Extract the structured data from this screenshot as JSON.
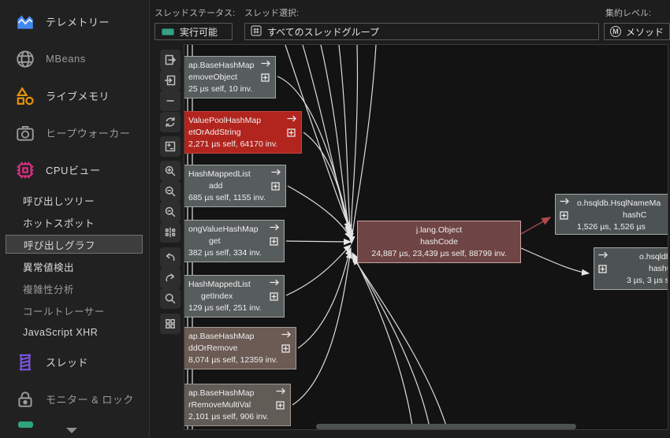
{
  "colors": {
    "background": "#1d1d1d",
    "accent_blue": "#4387f0",
    "accent_orange": "#e8930c",
    "accent_pink": "#dd2f84",
    "accent_purple": "#7e55e8",
    "accent_green": "#2fa47c",
    "node_gray": "#575c5c",
    "node_red": "#b2251e",
    "node_center_maroon": "#6f4444",
    "edge_color": "#dcdcdc",
    "edge_highlight_red": "#a04a50"
  },
  "topbar": {
    "thread_status_label": "スレッドステータス:",
    "thread_status_value": "実行可能",
    "thread_status_icon": "runnable-green-swatch",
    "thread_selection_label": "スレッド選択:",
    "thread_selection_value": "すべてのスレッドグループ",
    "thread_selection_icon": "thread-group-grid-icon",
    "aggregation_label": "集約レベル:",
    "aggregation_value": "メソッド",
    "aggregation_icon": "method-m-circle-icon",
    "aggregation_icon_letter": "M"
  },
  "sidebar": {
    "items": [
      {
        "label": "テレメトリー",
        "icon": "telemetry-chart-icon",
        "dim": false
      },
      {
        "label": "MBeans",
        "icon": "mbeans-globe-icon",
        "dim": true
      },
      {
        "label": "ライブメモリ",
        "icon": "live-memory-shapes-icon",
        "dim": false
      },
      {
        "label": "ヒープウォーカー",
        "icon": "heap-walker-camera-icon",
        "dim": true
      },
      {
        "label": "CPUビュー",
        "icon": "cpu-chip-icon",
        "dim": false
      }
    ],
    "cpu_subitems": [
      {
        "label": "呼び出しツリー",
        "selected": false
      },
      {
        "label": "ホットスポット",
        "selected": false
      },
      {
        "label": "呼び出しグラフ",
        "selected": true
      },
      {
        "label": "異常値検出",
        "selected": false
      },
      {
        "label": "複雑性分析",
        "selected": false
      },
      {
        "label": "コールトレーサー",
        "selected": false
      },
      {
        "label": "JavaScript XHR",
        "selected": false
      }
    ],
    "bottom_items": [
      {
        "label": "スレッド",
        "icon": "threads-spool-icon"
      },
      {
        "label": "モニター & ロック",
        "icon": "lock-icon"
      }
    ],
    "scroll_indicator": "chevron-down"
  },
  "toolbar": {
    "icons": [
      "move-out",
      "move-in",
      "remove-node",
      "refresh",
      "node-detail",
      "zoom-in",
      "zoom-out",
      "zoom-fit",
      "graph-layout",
      "undo",
      "redo",
      "find",
      "overview"
    ]
  },
  "graph": {
    "nodes": [
      {
        "id": "removeObject",
        "line1": "ap.BaseHashMap",
        "line2": "emoveObject",
        "line3": "25 µs self, 10 inv."
      },
      {
        "id": "getOrAddString",
        "line1": "ValuePoolHashMap",
        "line2": "etOrAddString",
        "line3": "2,271 µs self, 64170 inv."
      },
      {
        "id": "add",
        "line1": "HashMappedList",
        "line2": "add",
        "line3": "685 µs self, 1155 inv."
      },
      {
        "id": "get",
        "line1": "ongValueHashMap",
        "line2": "get",
        "line3": "382 µs self, 334 inv."
      },
      {
        "id": "getIndex",
        "line1": "HashMappedList",
        "line2": "getIndex",
        "line3": "129 µs self, 251 inv."
      },
      {
        "id": "addOrRemove",
        "line1": "ap.BaseHashMap",
        "line2": "ddOrRemove",
        "line3": "8,074 µs self, 12359 inv."
      },
      {
        "id": "removeMultiVal",
        "line1": "ap.BaseHashMap",
        "line2": "rRemoveMultiVal",
        "line3": "2,101 µs self, 906 inv."
      },
      {
        "id": "hashCode",
        "line1": "j.lang.Object",
        "line2": "hashCode",
        "line3": "24,887 µs, 23,439 µs self, 88799 inv."
      },
      {
        "id": "hsqlNameMa",
        "line1": "o.hsqldb.HsqlNameMa",
        "line2": "hashC",
        "line3": "1,526 µs, 1,526 µs"
      },
      {
        "id": "hsqldbEx",
        "line1": "o.hsqldb.Ex",
        "line2": "hashC",
        "line3": "3 µs, 3 µs s"
      }
    ]
  }
}
